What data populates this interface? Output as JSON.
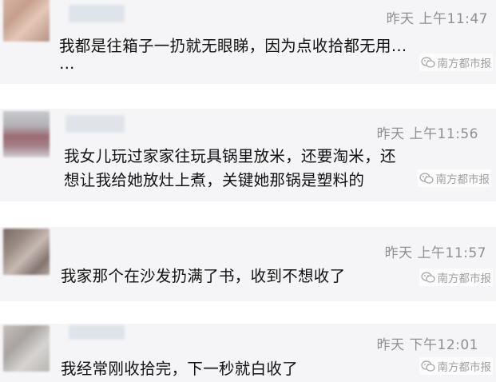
{
  "comments": [
    {
      "time": "昨天 上午11:47",
      "lines": [
        "我都是往箱子一扔就无眼睇，因为点收拾都无用…",
        "…"
      ],
      "watermark": "南方都市报"
    },
    {
      "time": "昨天 上午11:56",
      "lines": [
        "我女儿玩过家家往玩具锅里放米，还要淘米，还",
        "想让我给她放灶上煮，关键她那锅是塑料的"
      ],
      "watermark": "南方都市报"
    },
    {
      "time": "昨天 上午11:57",
      "lines": [
        "我家那个在沙发扔满了书，收到不想收了"
      ],
      "watermark": "南方都市报"
    },
    {
      "time": "昨天 下午12:01",
      "lines": [
        "我经常刚收拾完，下一秒就白收了"
      ],
      "watermark": "南方都市报"
    }
  ],
  "icons": {
    "watermark_icon": "wechat-icon",
    "avatar": "blurred-avatar",
    "username": "blurred-username"
  }
}
